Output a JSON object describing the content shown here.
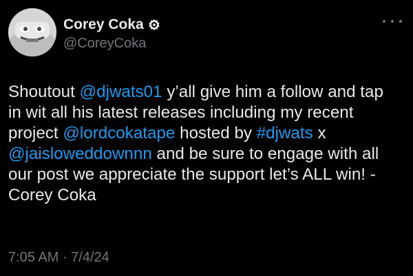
{
  "author": {
    "display_name": "Corey Coka",
    "handle": "@CoreyCoka",
    "badge_icon": "verified-badge-icon",
    "avatar_icon": "car-avatar-icon"
  },
  "tweet": {
    "lines": [
      [
        {
          "t": "text",
          "v": "Shoutout "
        },
        {
          "t": "mention",
          "v": "@djwats01"
        },
        {
          "t": "text",
          "v": " y’all give him a follow and tap"
        }
      ],
      [
        {
          "t": "text",
          "v": "in wit all his latest releases including my recent"
        }
      ],
      [
        {
          "t": "text",
          "v": "project "
        },
        {
          "t": "mention",
          "v": "@lordcokatape"
        },
        {
          "t": "text",
          "v": " hosted by "
        },
        {
          "t": "hashtag",
          "v": "#djwats"
        },
        {
          "t": "text",
          "v": " x"
        }
      ],
      [
        {
          "t": "mention",
          "v": "@jaisloweddownnn"
        },
        {
          "t": "text",
          "v": " and be sure to engage with all"
        }
      ],
      [
        {
          "t": "text",
          "v": "our post we appreciate the support let’s ALL win! -"
        }
      ],
      [
        {
          "t": "text",
          "v": "Corey Coka"
        }
      ]
    ]
  },
  "meta": {
    "time": "7:05 AM",
    "separator": " · ",
    "date": "7/4/24"
  },
  "colors": {
    "background": "#000000",
    "text": "#e7e9ea",
    "link": "#1d9bf0",
    "secondary": "#71767b"
  }
}
